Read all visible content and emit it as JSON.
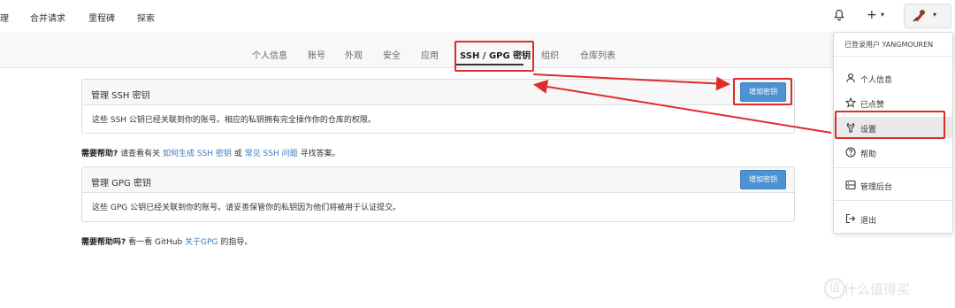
{
  "topnav": {
    "items": [
      "理",
      "合并请求",
      "里程碑",
      "探索"
    ],
    "plus_label": "+",
    "caret": "▾"
  },
  "tabs": [
    "个人信息",
    "账号",
    "外观",
    "安全",
    "应用",
    "SSH / GPG 密钥",
    "组织",
    "仓库列表"
  ],
  "ssh": {
    "title": "管理 SSH 密钥",
    "add_button": "增加密钥",
    "body": "这些 SSH 公钥已经关联到你的账号。相应的私钥拥有完全操作你的仓库的权限。"
  },
  "help1": {
    "bold": "需要帮助?",
    "text1": "请查看有关",
    "link1": "如何生成 SSH 密钥",
    "text2": "或",
    "link2": "常见 SSH 问题",
    "text3": "寻找答案。"
  },
  "gpg": {
    "title": "管理 GPG 密钥",
    "add_button": "增加密钥",
    "body": "这些 GPG 公钥已经关联到你的账号。请妥善保管你的私钥因为他们将被用于认证提交。"
  },
  "help2": {
    "bold": "需要帮助吗?",
    "text1": "看一看 GitHub",
    "link": "关于GPG",
    "text2": "的指导。"
  },
  "dropdown": {
    "header": "已登录用户 YANGMOUREN",
    "items": [
      {
        "label": "个人信息",
        "icon": "person-icon"
      },
      {
        "label": "已点赞",
        "icon": "star-icon"
      },
      {
        "label": "设置",
        "icon": "wrench-icon"
      },
      {
        "label": "帮助",
        "icon": "help-icon"
      },
      {
        "label": "管理后台",
        "icon": "server-icon"
      },
      {
        "label": "退出",
        "icon": "signout-icon"
      }
    ]
  },
  "annotation_color": "#e02b2b",
  "accent": "#4d92d1",
  "watermark": {
    "badge": "值",
    "text": "什么值得买"
  }
}
